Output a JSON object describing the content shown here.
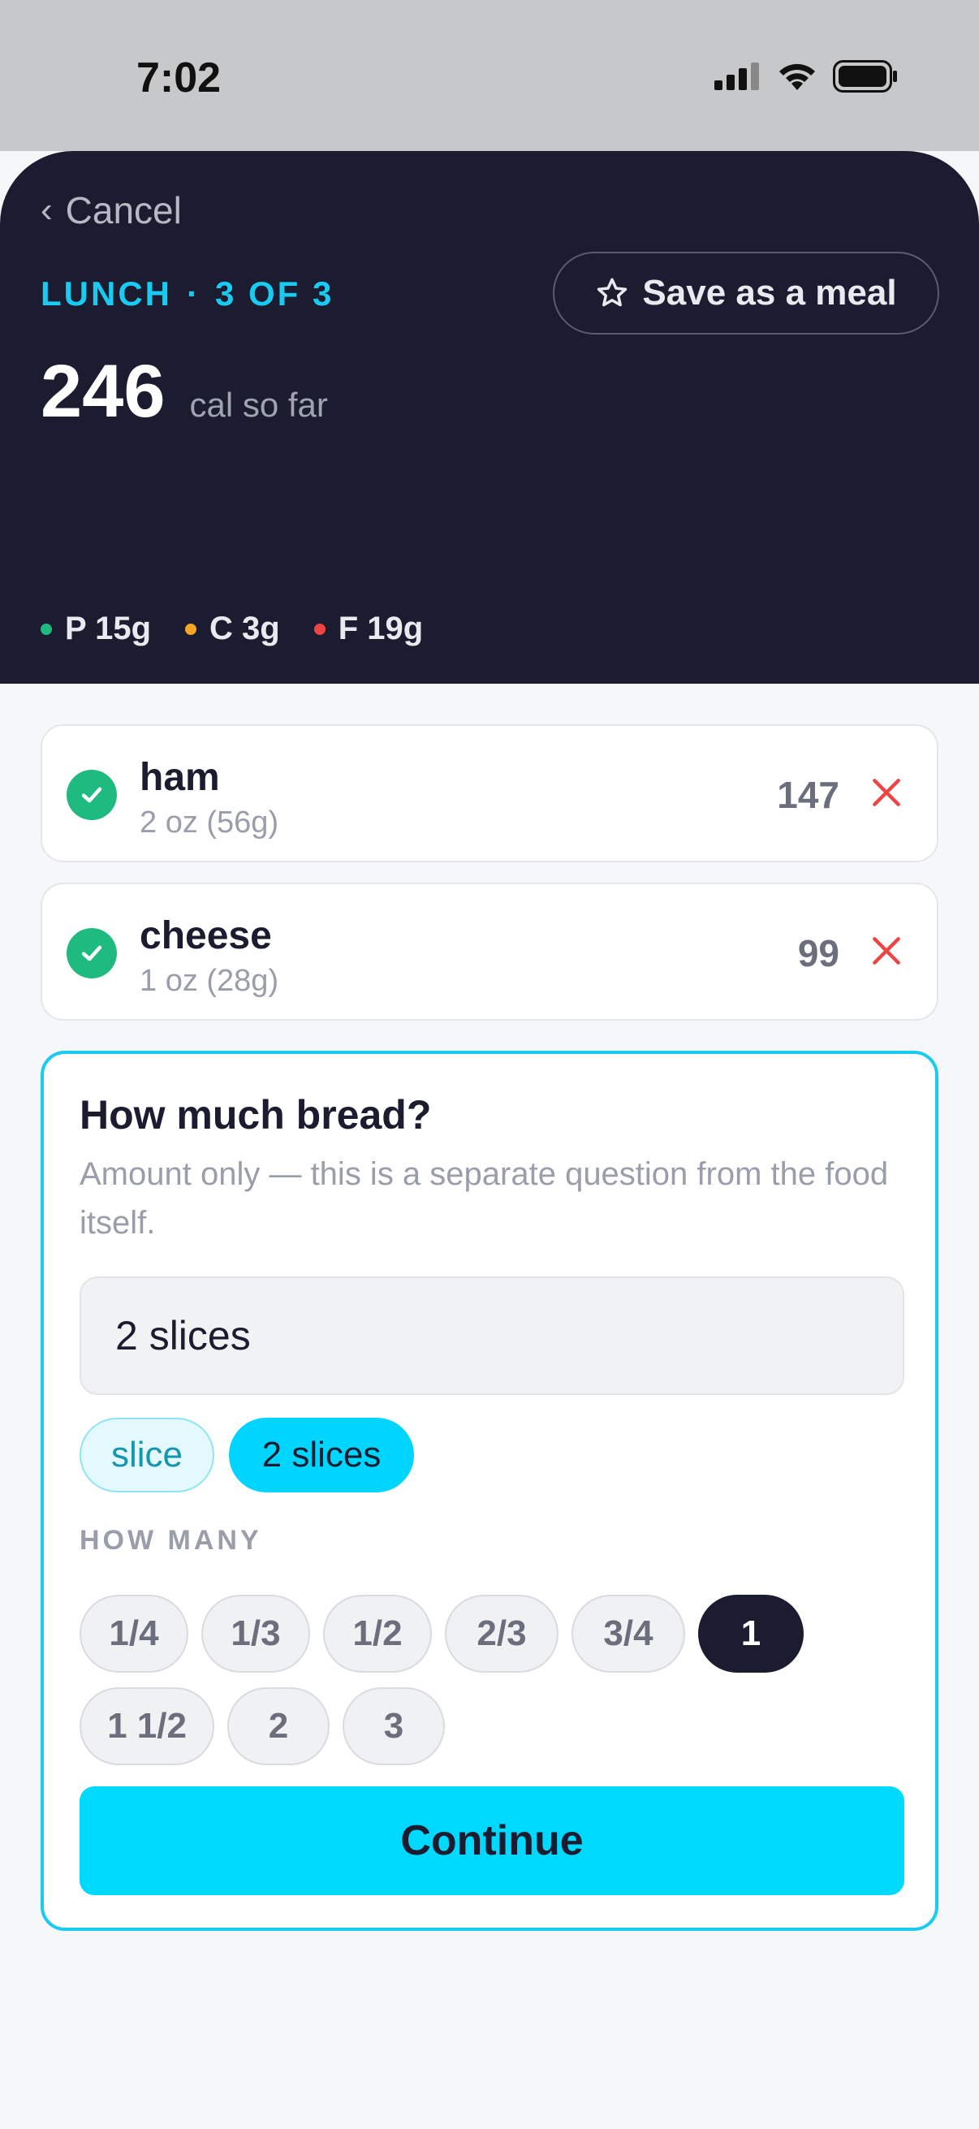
{
  "status_bar": {
    "time": "7:02"
  },
  "header": {
    "cancel_label": "Cancel",
    "meal": "LUNCH",
    "separator": "·",
    "step": "3 OF 3",
    "save_label": "Save as a meal",
    "calories": "246",
    "calories_label": "cal so far",
    "macros": [
      {
        "label": "P 15g",
        "color": "#1fba7f"
      },
      {
        "label": "C 3g",
        "color": "#f5a524"
      },
      {
        "label": "F 19g",
        "color": "#ef4444"
      }
    ]
  },
  "foods": [
    {
      "name": "ham",
      "portion": "2 oz (56g)",
      "calories": "147"
    },
    {
      "name": "cheese",
      "portion": "1 oz (28g)",
      "calories": "99"
    }
  ],
  "question": {
    "title": "How much bread?",
    "help": "Amount only — this is a separate question from the food itself.",
    "amount_value": "2 slices",
    "units": [
      "slice",
      "2 slices"
    ],
    "selected_unit": "2 slices",
    "how_many_label": "HOW MANY",
    "quantities": [
      "1/4",
      "1/3",
      "1/2",
      "2/3",
      "3/4",
      "1",
      "1 1/2",
      "2",
      "3"
    ],
    "selected_quantity": "1",
    "continue_label": "Continue"
  },
  "colors": {
    "accent": "#00d9ff",
    "header_bg": "#1b1c2f",
    "check_green": "#1fba7f",
    "remove_red": "#ef4444"
  }
}
